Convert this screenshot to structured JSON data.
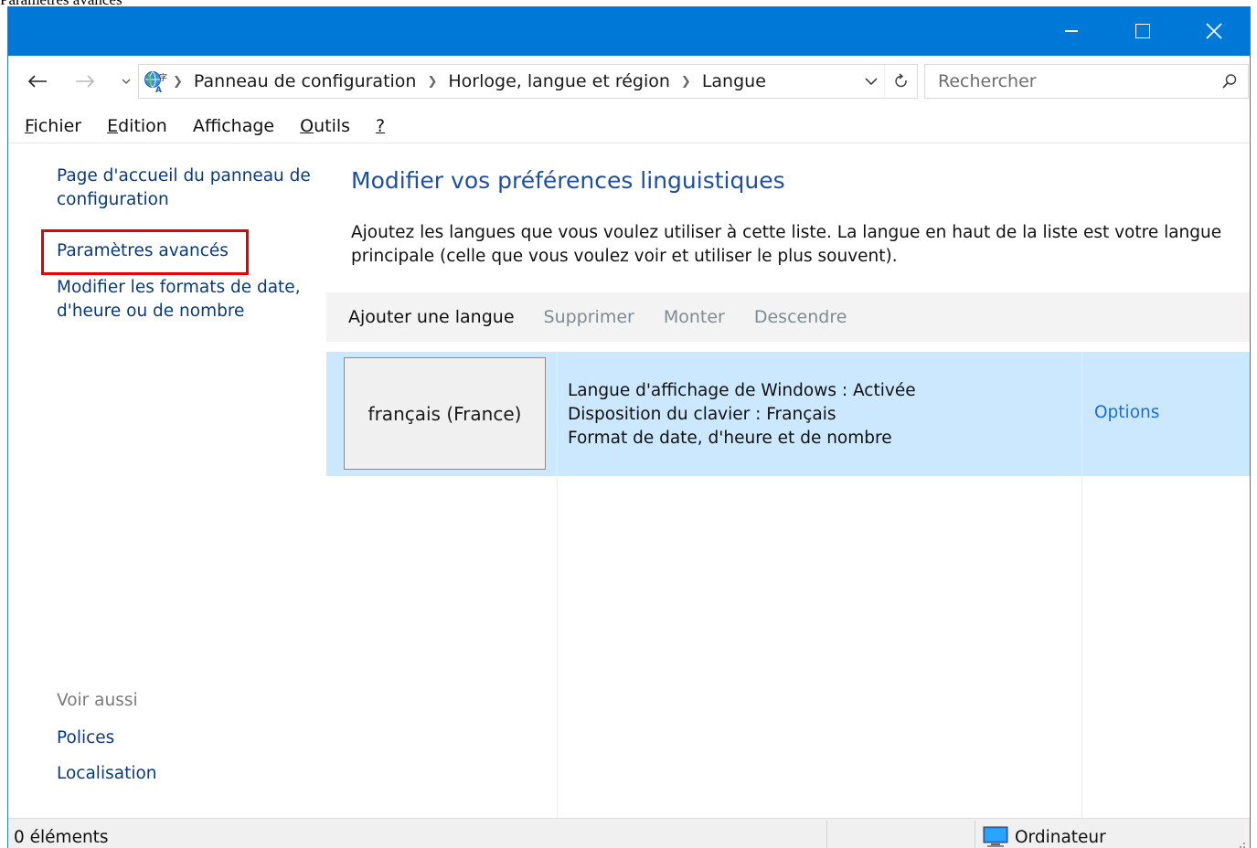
{
  "page_caption": "Paramètres avancés",
  "window": {
    "controls": {
      "minimize": "minimize-icon",
      "maximize": "maximize-icon",
      "close": "close-icon"
    }
  },
  "address": {
    "crumbs": [
      "Panneau de configuration",
      "Horloge, langue et région",
      "Langue"
    ],
    "search_placeholder": "Rechercher"
  },
  "menu": {
    "items": [
      {
        "key": "F",
        "rest": "ichier"
      },
      {
        "key": "E",
        "rest": "dition"
      },
      {
        "prefix": "Afficha",
        "key": "g",
        "rest": "e"
      },
      {
        "key": "O",
        "rest": "utils"
      },
      {
        "key": "?",
        "rest": ""
      }
    ]
  },
  "sidebar": {
    "home_link_1": "Page d'accueil du panneau de",
    "home_link_2": "configuration",
    "advanced_link": "Paramètres avancés",
    "formats_link_1": "Modifier les formats de date,",
    "formats_link_2": "d'heure ou de nombre",
    "see_also": "Voir aussi",
    "fonts_link": "Polices",
    "location_link": "Localisation"
  },
  "content": {
    "title": "Modifier vos préférences linguistiques",
    "desc_1": "Ajoutez les langues que vous voulez utiliser à cette liste. La langue en haut de la liste est votre langue",
    "desc_2": "principale (celle que vous voulez voir et utiliser le plus souvent)."
  },
  "toolbar": {
    "add": "Ajouter une langue",
    "remove": "Supprimer",
    "up": "Monter",
    "down": "Descendre"
  },
  "languages": [
    {
      "name": "français (France)",
      "line1": "Langue d'affichage de Windows : Activée",
      "line2": "Disposition du clavier : Français",
      "line3": "Format de date, d'heure et de nombre",
      "options": "Options"
    }
  ],
  "status": {
    "count": "0 éléments",
    "zone": "Ordinateur"
  },
  "colors": {
    "titlebar": "#0078d7",
    "selected_row": "#cce8ff",
    "link": "#0b3a75",
    "title_blue": "#1e4f9b",
    "highlight_border": "#e60000"
  }
}
